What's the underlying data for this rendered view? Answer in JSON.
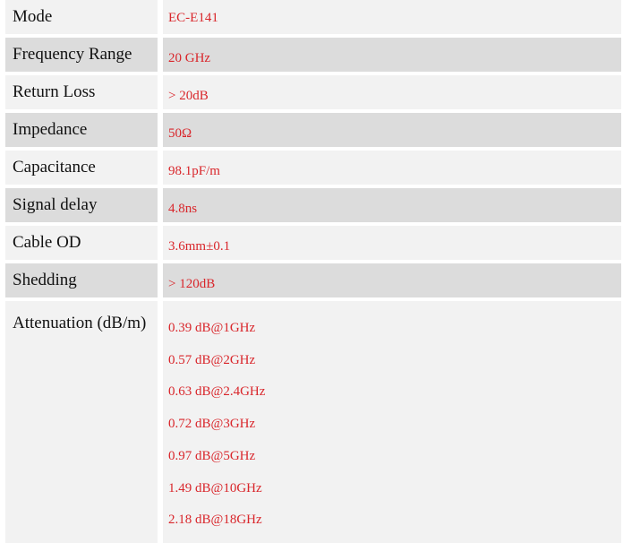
{
  "specs": [
    {
      "label": "Mode",
      "value": "EC-E141"
    },
    {
      "label": "Frequency Range",
      "value": "20 GHz"
    },
    {
      "label": "Return Loss",
      "value": "> 20dB"
    },
    {
      "label": "Impedance",
      "value": "50Ω"
    },
    {
      "label": "Capacitance",
      "value": "98.1pF/m"
    },
    {
      "label": "Signal delay",
      "value": "4.8ns"
    },
    {
      "label": "Cable OD",
      "value": "3.6mm±0.1"
    },
    {
      "label": "Shedding",
      "value": "> 120dB"
    }
  ],
  "attenuation": {
    "label": "Attenuation (dB/m)",
    "values": [
      "0.39 dB@1GHz",
      "0.57 dB@2GHz",
      "0.63 dB@2.4GHz",
      "0.72 dB@3GHz",
      "0.97 dB@5GHz",
      "1.49 dB@10GHz",
      "2.18 dB@18GHz"
    ]
  },
  "colors": {
    "value_text": "#d9262b",
    "label_text": "#111111",
    "shaded_row": "#dcdcdc",
    "plain_row": "#f2f2f2"
  }
}
